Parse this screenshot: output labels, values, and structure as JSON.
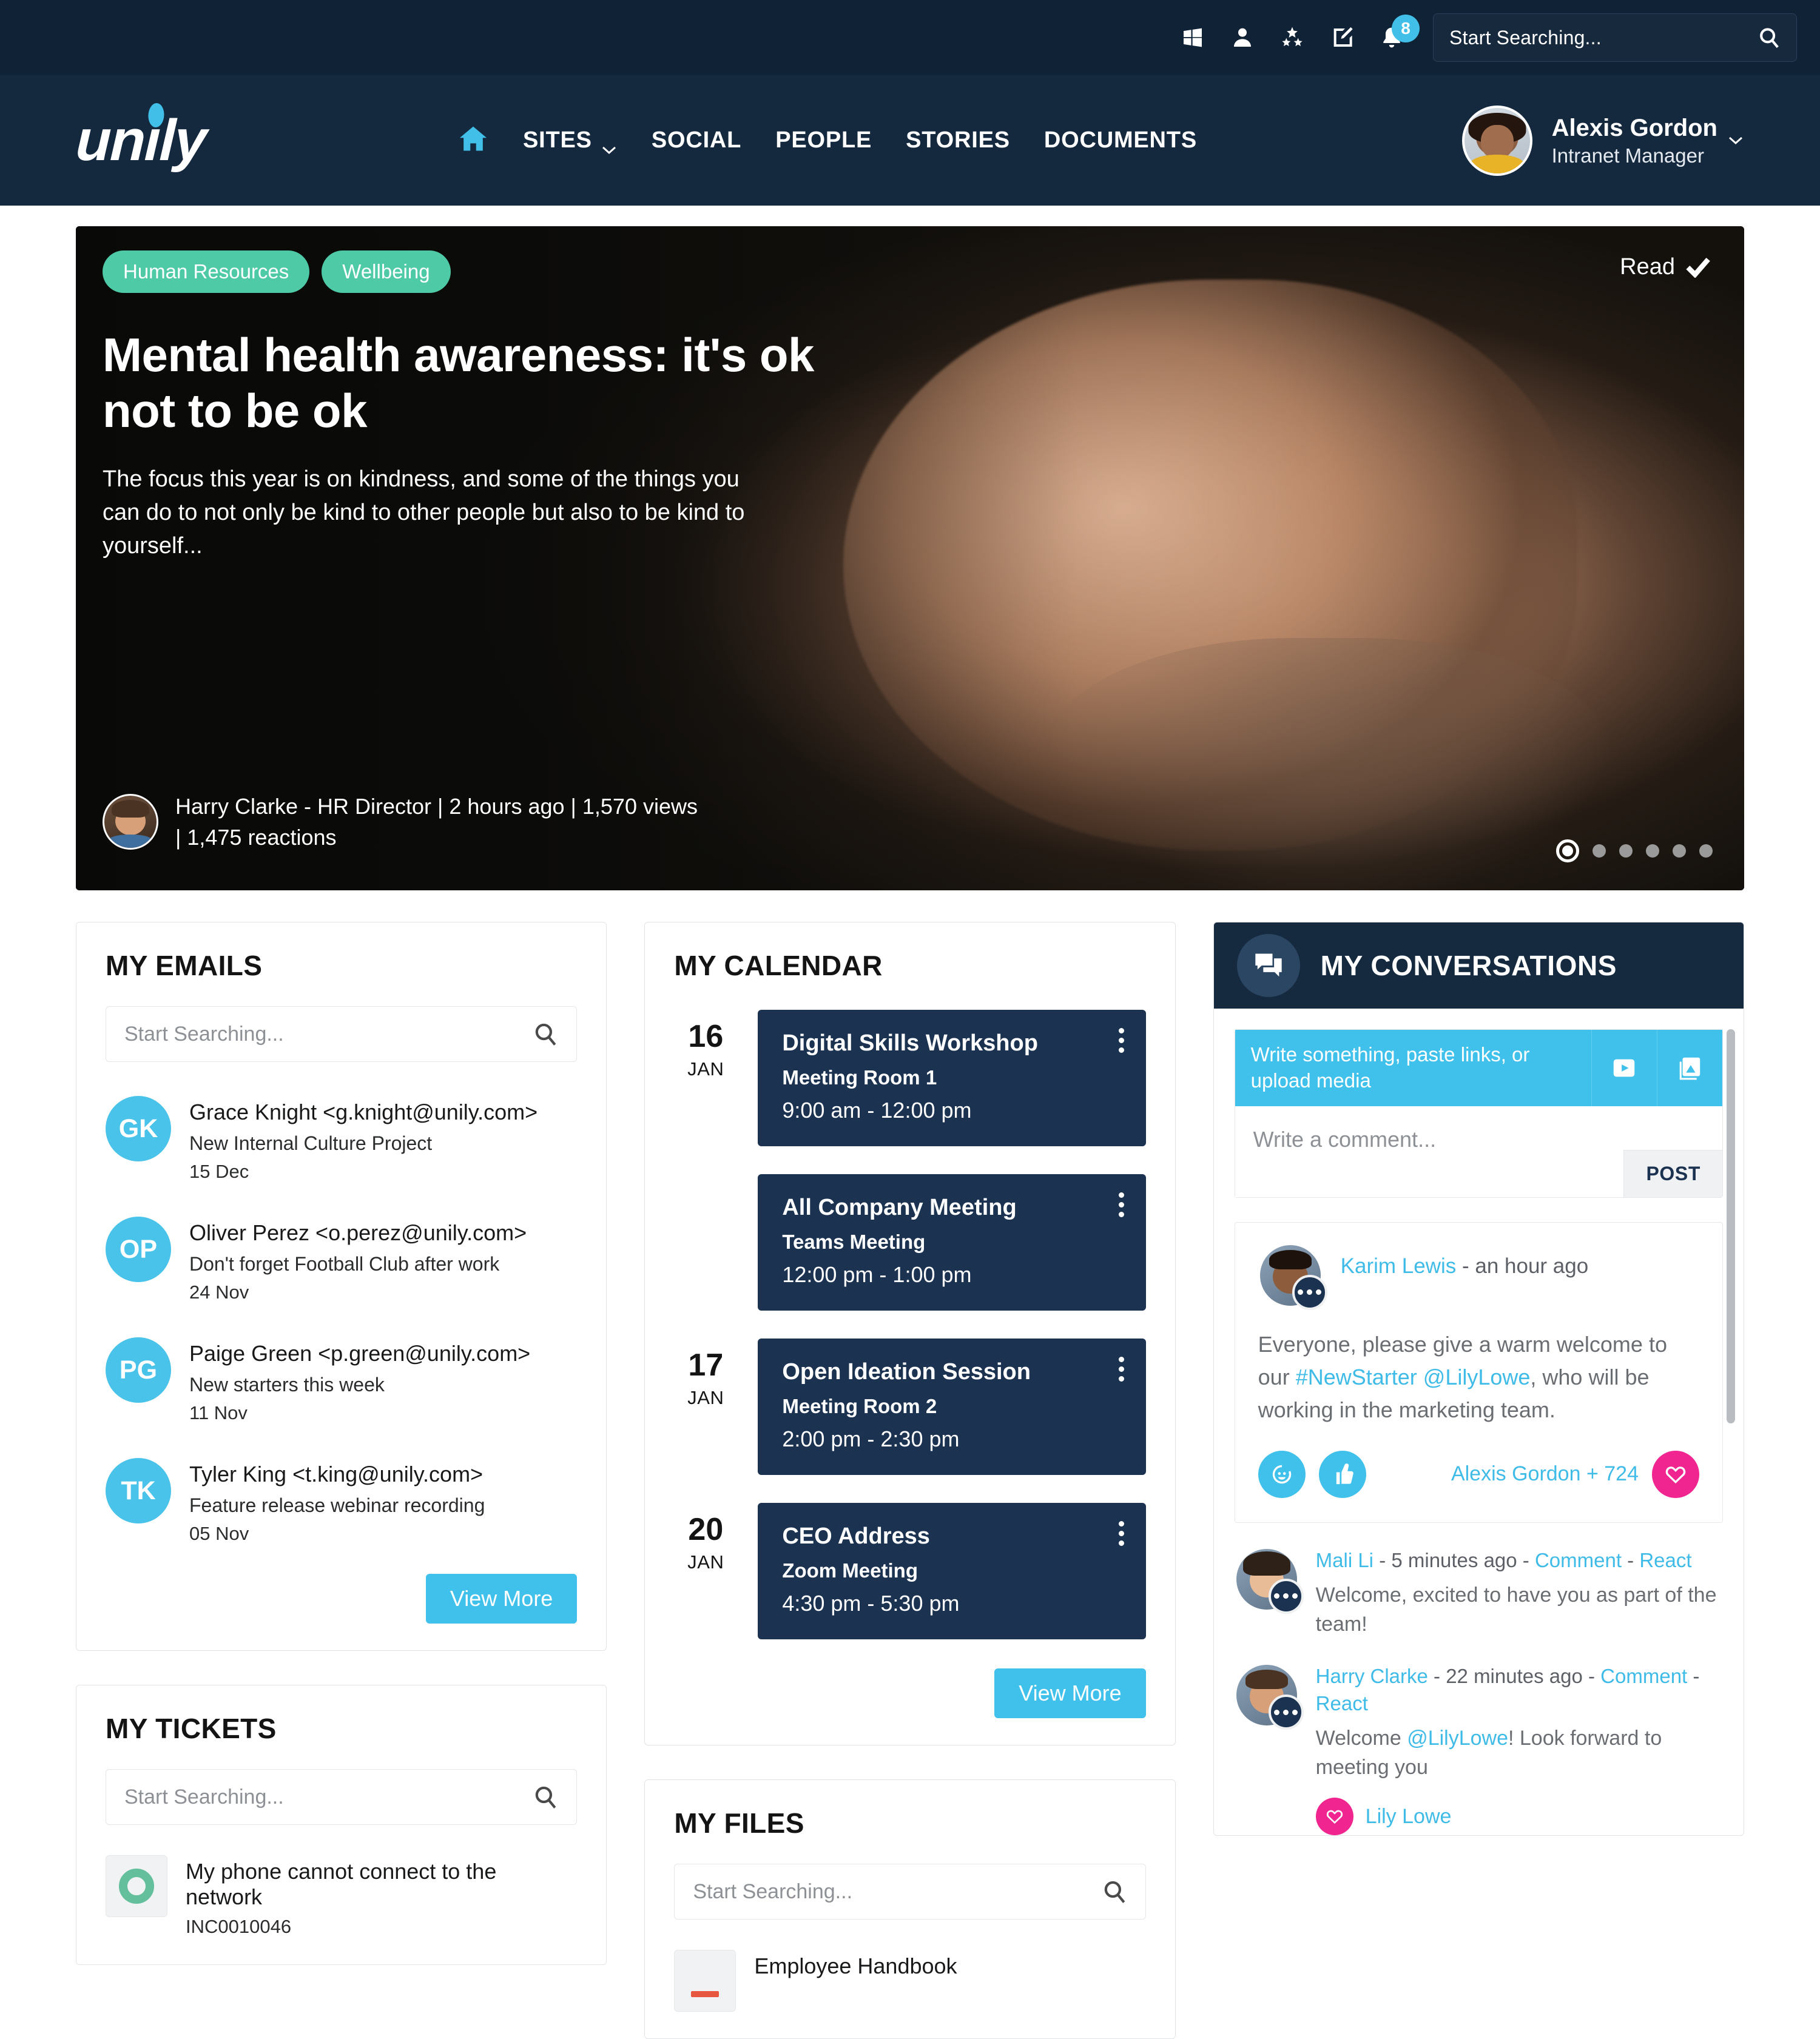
{
  "utility_bar": {
    "icons": [
      {
        "name": "windows-icon",
        "label": "Windows apps"
      },
      {
        "name": "person-icon",
        "label": "My profile"
      },
      {
        "name": "stars-icon",
        "label": "Favourites"
      },
      {
        "name": "compose-icon",
        "label": "Create"
      },
      {
        "name": "bell-icon",
        "label": "Notifications"
      }
    ],
    "notification_count": "8",
    "search_placeholder": "Start Searching..."
  },
  "header": {
    "logo_text": "unily",
    "nav": [
      {
        "label": "SITES",
        "has_chevron": true
      },
      {
        "label": "SOCIAL",
        "has_chevron": false
      },
      {
        "label": "PEOPLE",
        "has_chevron": false
      },
      {
        "label": "STORIES",
        "has_chevron": false
      },
      {
        "label": "DOCUMENTS",
        "has_chevron": false
      }
    ],
    "user": {
      "name": "Alexis Gordon",
      "role": "Intranet Manager"
    }
  },
  "hero": {
    "tags": [
      "Human Resources",
      "Wellbeing"
    ],
    "read_label": "Read",
    "title": "Mental health awareness: it's ok not to be ok",
    "summary": "The focus this year is on kindness, and some of the things you can do to not only be kind to other people but also to be kind to yourself...",
    "byline": "Harry Clarke - HR Director | 2 hours ago | 1,570 views | 1,475 reactions",
    "carousel": {
      "total": 6,
      "active_index": 0
    }
  },
  "emails": {
    "title": "MY EMAILS",
    "search_placeholder": "Start Searching...",
    "view_more_label": "View More",
    "items": [
      {
        "initials": "GK",
        "from": "Grace Knight <g.knight@unily.com>",
        "subject": "New Internal Culture Project",
        "date": "15 Dec"
      },
      {
        "initials": "OP",
        "from": "Oliver Perez <o.perez@unily.com>",
        "subject": "Don't forget Football Club after work",
        "date": "24 Nov"
      },
      {
        "initials": "PG",
        "from": "Paige Green <p.green@unily.com>",
        "subject": "New starters this week",
        "date": "11 Nov"
      },
      {
        "initials": "TK",
        "from": "Tyler King <t.king@unily.com>",
        "subject": "Feature release webinar recording",
        "date": "05 Nov"
      }
    ]
  },
  "tickets": {
    "title": "MY TICKETS",
    "search_placeholder": "Start Searching...",
    "items": [
      {
        "title": "My phone cannot connect to the network",
        "reference": "INC0010046"
      }
    ]
  },
  "calendar": {
    "title": "MY CALENDAR",
    "view_more_label": "View More",
    "events": [
      {
        "day": "16",
        "month": "JAN",
        "show_date": true,
        "name": "Digital Skills Workshop",
        "location": "Meeting Room 1",
        "time": "9:00 am - 12:00 pm"
      },
      {
        "day": "",
        "month": "",
        "show_date": false,
        "name": "All Company Meeting",
        "location": "Teams Meeting",
        "time": "12:00 pm - 1:00 pm"
      },
      {
        "day": "17",
        "month": "JAN",
        "show_date": true,
        "name": "Open Ideation Session",
        "location": "Meeting Room 2",
        "time": "2:00 pm - 2:30 pm"
      },
      {
        "day": "20",
        "month": "JAN",
        "show_date": true,
        "name": "CEO Address",
        "location": "Zoom Meeting",
        "time": "4:30 pm - 5:30 pm"
      }
    ]
  },
  "files": {
    "title": "MY FILES",
    "search_placeholder": "Start Searching...",
    "items": [
      {
        "title": "Employee Handbook"
      }
    ]
  },
  "conversations": {
    "title": "MY CONVERSATIONS",
    "composer": {
      "placeholder": "Write something, paste links, or upload media",
      "comment_placeholder": "Write a comment...",
      "post_label": "POST",
      "video_icon": "video-icon",
      "image_icon": "image-icon"
    },
    "post": {
      "author": "Karim Lewis",
      "timestamp": "- an hour ago",
      "body_part1": "Everyone, please give a warm welcome to our ",
      "body_hashtag": "#NewStarter @LilyLowe",
      "body_part2": ", who will be working in the marketing team.",
      "reactors": "Alexis Gordon + 724"
    },
    "comments": [
      {
        "author": "Mali Li",
        "timestamp": "- 5 minutes ago - ",
        "comment_link": "Comment",
        "sep": " - ",
        "react_link": "React",
        "text": "Welcome, excited to have you as part of the team!",
        "liker": ""
      },
      {
        "author": "Harry Clarke",
        "timestamp": "- 22 minutes ago - ",
        "comment_link": "Comment",
        "sep": " - ",
        "react_link": "React",
        "text_pre": "Welcome ",
        "text_mention": "@LilyLowe",
        "text_post": "! Look forward to meeting you",
        "liker": "Lily Lowe"
      }
    ]
  },
  "colors": {
    "brand_cyan": "#40c1ec",
    "navy": "#15293e",
    "dark_navy": "#102236",
    "tag_green": "#4ecaa6",
    "pink": "#f0258f",
    "event_navy": "#1b3250"
  }
}
